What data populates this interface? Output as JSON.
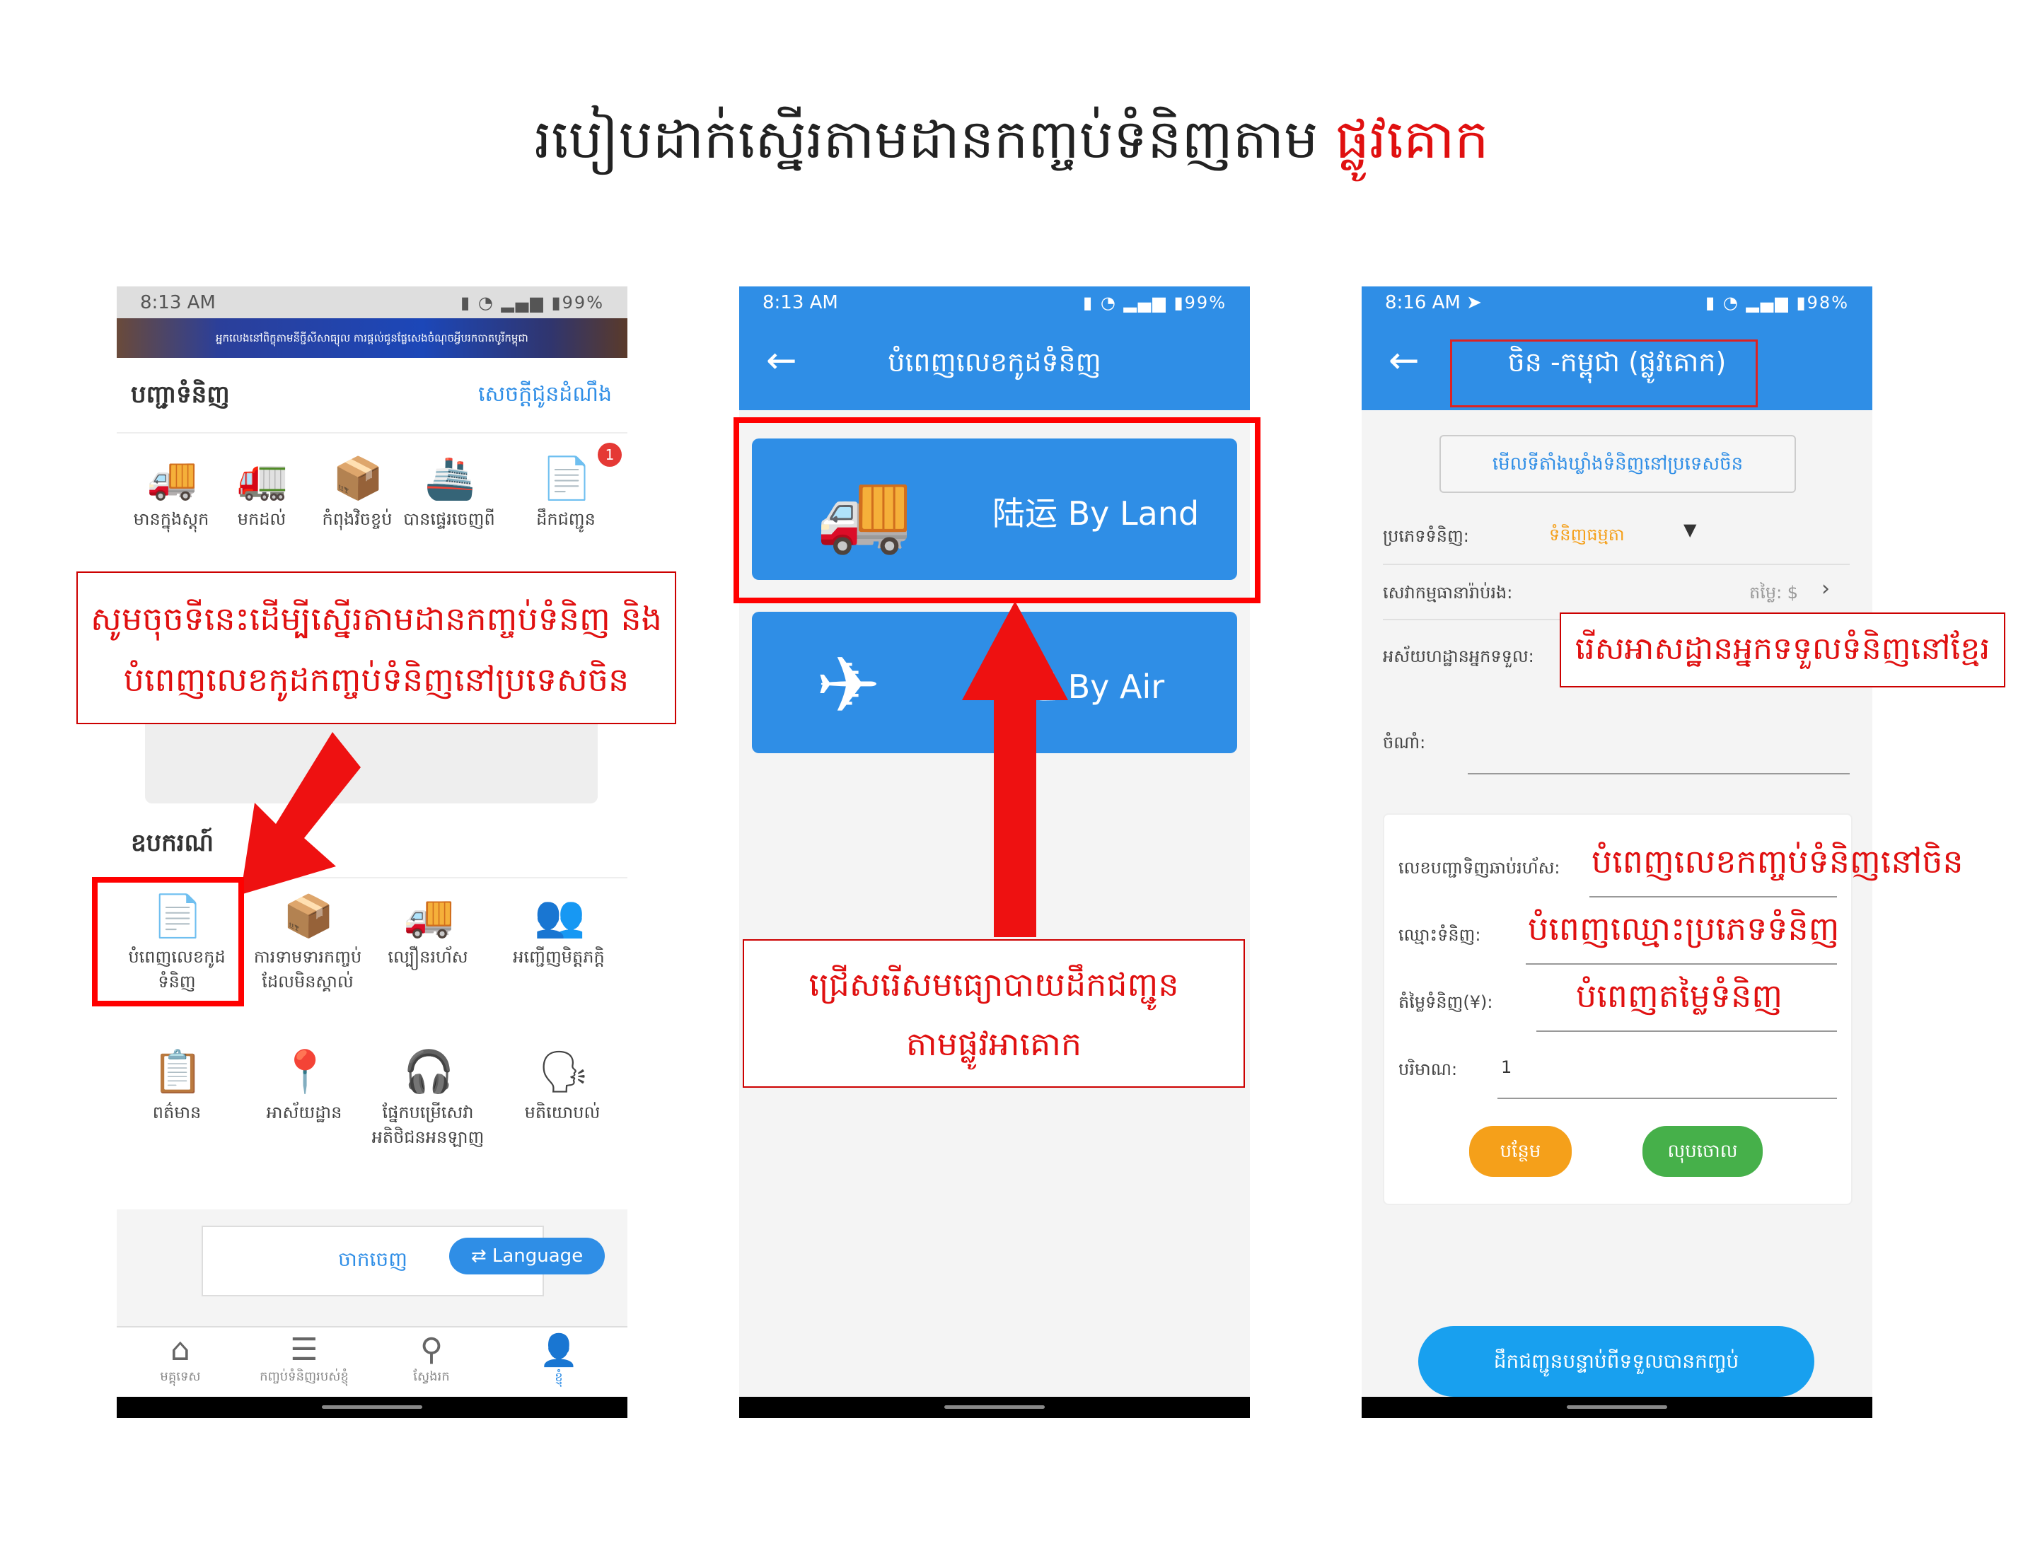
{
  "title": {
    "main": "របៀបដាក់ស្នើរតាមដានកញ្ចប់ទំនិញតាម ",
    "highlight": "ផ្លូវគោក"
  },
  "phone1": {
    "status": {
      "time": "8:13 AM",
      "battery": "99%"
    },
    "banner_text": "អ្នកលេងនៅពិក្ខុតាមនីច្ជីសីសាធ្យុល ការផ្តល់ជូនផ្លែសេងចំណុចអ្វីបរកបាតបូរីកម្ពុជា",
    "orders_title": "បញ្ជាទំនិញ",
    "notification_link": "សេចក្ដីជូនដំណឹង",
    "order_items": [
      {
        "label": "មានក្នុងស្តុក",
        "icon": "🚚"
      },
      {
        "label": "មកដល់",
        "icon": "🚛"
      },
      {
        "label": "កំពុងវិចខ្ចប់",
        "icon": "📦"
      },
      {
        "label": "បានផ្ទេរចេញពី",
        "icon": "🚢"
      },
      {
        "label": "ដឹកជញ្ជូន",
        "icon": "📄",
        "badge": "1"
      }
    ],
    "tools_title": "ឧបករណ៍",
    "tool_items": [
      {
        "label": "បំពេញលេខកូដទំនិញ",
        "icon": "📄"
      },
      {
        "label": "ការទាមទារកញ្ចប់ដែលមិនស្គាល់",
        "icon": "📦"
      },
      {
        "label": "ល្បឿនរហ័ស",
        "icon": "🚚"
      },
      {
        "label": "អញ្ជើញមិត្តភក្តិ",
        "icon": "👥"
      },
      {
        "label": "ពត៌មាន",
        "icon": "📋"
      },
      {
        "label": "អាស័យដ្ឋាន",
        "icon": "📍"
      },
      {
        "label": "ផ្នែកបម្រើសេវាអតិថិជនអនឡាញ",
        "icon": "🎧"
      },
      {
        "label": "មតិយោបល់",
        "icon": "🗣"
      }
    ],
    "logout_label": "ចាកចេញ",
    "language_label": "Language",
    "bottom_nav": [
      {
        "label": "មគ្គុទេស",
        "icon": "⌂"
      },
      {
        "label": "កញ្ចប់ទំនិញរបស់ខ្ញុំ",
        "icon": "☰"
      },
      {
        "label": "ស្វែងរក",
        "icon": "⚲"
      },
      {
        "label": "ខ្ញុំ",
        "icon": "👤"
      }
    ],
    "annotation": "សូមចុចទីនេះដើម្បីស្នើរតាមដានកញ្ចប់ទំនិញ និង បំពេញលេខកូដកញ្ចប់ទំនិញនៅប្រទេសចិន"
  },
  "phone2": {
    "status": {
      "time": "8:13 AM",
      "battery": "99%"
    },
    "nav_title": "បំពេញលេខកូដទំនិញ",
    "land_label": "陆运 By Land",
    "air_label": "空运 By Air",
    "annotation": "ជ្រើសរើសមធ្យោបាយដឹកជញ្ជូនតាមផ្លូវអាគោក"
  },
  "phone3": {
    "status": {
      "time": "8:16 AM",
      "battery": "98%"
    },
    "nav_title": "ចិន -កម្ពុជា (ផ្លូវគោក)",
    "warehouse_button": "មើលទីតាំងឃ្លាំងទំនិញនៅប្រទេសចិន",
    "type_label": "ប្រភេទទំនិញ:",
    "type_value": "ទំនិញធម្មតា",
    "insurance_label": "សេវាកម្មធានារ៉ាប់រង:",
    "insurance_value": "តម្លៃ: $",
    "address_label": "អស័យហដ្ឋានអ្នកទទួល:",
    "note_label": "ចំណាំ:",
    "tracking_label": "លេខបញ្ជាទិញឆាប់រហ័ស:",
    "name_label": "ឈ្មោះទំនិញ:",
    "price_label": "តំម្លៃទំនិញ(¥):",
    "qty_label": "បរិមាណ:",
    "qty_value": "1",
    "add_button": "បន្ថែម",
    "delete_button": "លុបចោល",
    "submit_button": "ដឹកជញ្ជូនបន្ទាប់ពីទទួលបានកញ្ចប់",
    "annot_address": "រើសអាសដ្ឋានអ្នកទទួលទំនិញនៅខ្មែរ",
    "annot_tracking": "បំពេញលេខកញ្ចប់ទំនិញនៅចិន",
    "annot_name": "បំពេញឈ្មោះប្រភេទទំនិញ",
    "annot_price": "បំពេញតម្លៃទំនិញ"
  },
  "colors": {
    "accent": "#2f8ee6",
    "annotation": "#e01010",
    "orange": "#f5a01a",
    "green": "#46b04a"
  }
}
